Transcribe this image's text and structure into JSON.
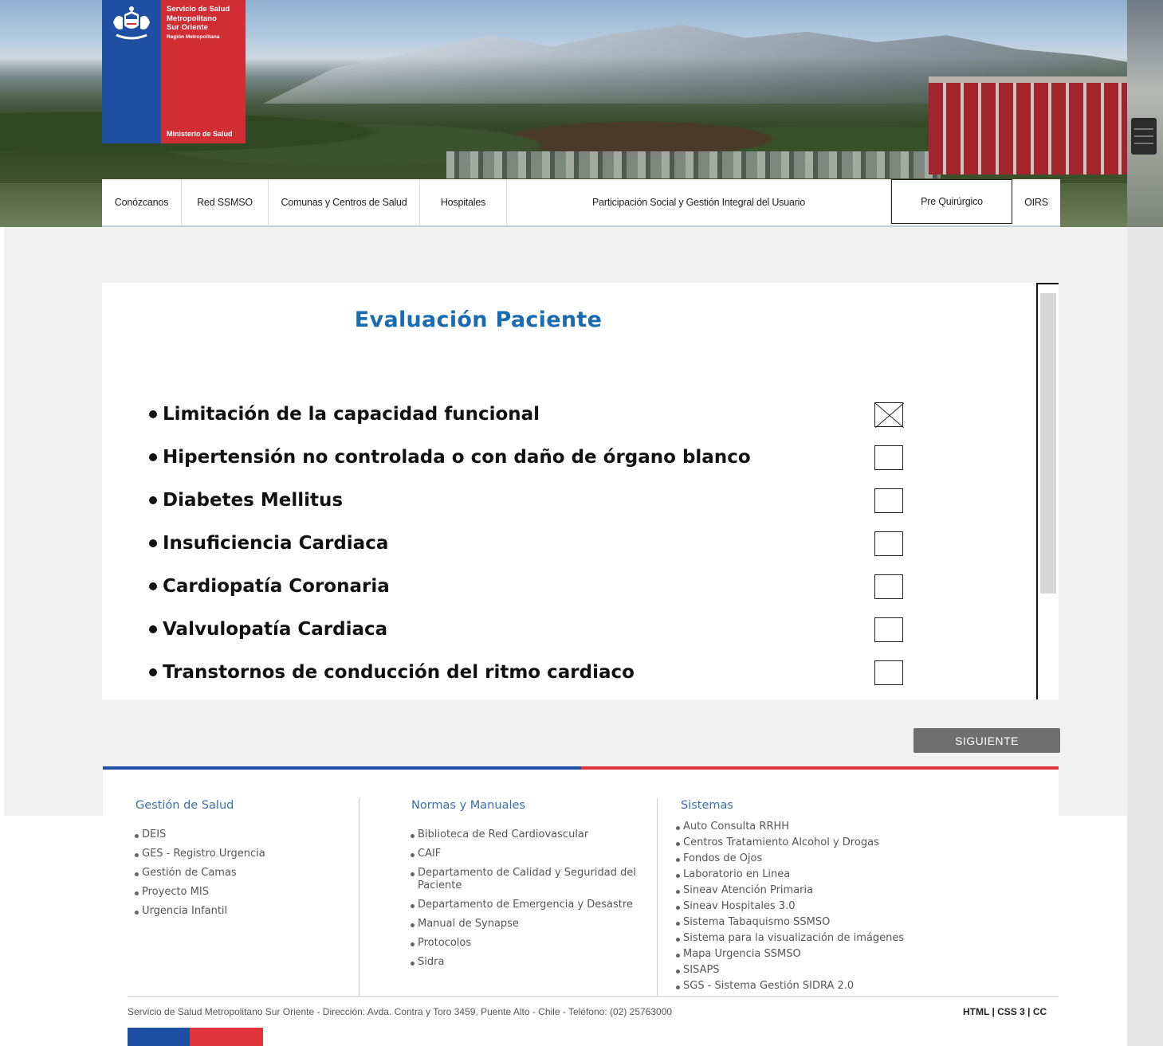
{
  "logo": {
    "line1": "Servicio de Salud",
    "line2": "Metropolitano",
    "line3": "Sur Oriente",
    "line4": "Región Metropolitana",
    "ministry": "Ministerio de Salud"
  },
  "nav": [
    {
      "label": "Conózcanos"
    },
    {
      "label": "Red SSMSO"
    },
    {
      "label": "Comunas y Centros de Salud"
    },
    {
      "label": "Hospitales"
    },
    {
      "label": "Participación Social y Gestión Integral del Usuario"
    },
    {
      "label": "Pre Quirúrgico",
      "active": true
    },
    {
      "label": "OIRS"
    }
  ],
  "form": {
    "title": "Evaluación Paciente",
    "items": [
      {
        "label": "Limitación de la capacidad funcional",
        "checked": true
      },
      {
        "label": "Hipertensión no controlada o con daño de órgano blanco",
        "checked": false
      },
      {
        "label": "Diabetes Mellitus",
        "checked": false
      },
      {
        "label": "Insuficiencia Cardiaca",
        "checked": false
      },
      {
        "label": "Cardiopatía Coronaria",
        "checked": false
      },
      {
        "label": "Valvulopatía Cardiaca",
        "checked": false
      },
      {
        "label": "Transtornos de conducción del ritmo cardiaco",
        "checked": false
      }
    ],
    "next_label": "SIGUIENTE"
  },
  "footer": {
    "col1": {
      "title": "Gestión de Salud",
      "links": [
        "DEIS",
        "GES - Registro Urgencia",
        "Gestión de Camas",
        "Proyecto MIS",
        "Urgencia Infantil"
      ]
    },
    "col2": {
      "title": "Normas y Manuales",
      "links": [
        "Biblioteca de Red Cardiovascular",
        "CAIF",
        "Departamento de Calidad y Seguridad del Paciente",
        "Departamento de Emergencia y Desastre",
        "Manual de Synapse",
        "Protocolos",
        "Sidra"
      ]
    },
    "col3": {
      "title": "Sistemas",
      "links": [
        "Auto Consulta RRHH",
        "Centros Tratamiento Alcohol y Drogas",
        "Fondos de Ojos",
        "Laboratorio en Linea",
        "Sineav Atención Primaria",
        "Sineav Hospitales 3.0",
        "Sistema Tabaquismo SSMSO",
        "Sistema para la visualización de imágenes",
        "Mapa Urgencia SSMSO",
        "SISAPS",
        "SGS - Sistema Gestión SIDRA 2.0"
      ]
    },
    "address": "Servicio de Salud Metropolitano Sur Oriente - Dirección: Avda. Contra y Toro 3459, Puente Alto - Chile - Teléfono: (02) 25763000",
    "standards": [
      "HTML",
      "CSS 3",
      "CC"
    ]
  },
  "colors": {
    "brand_blue": "#1f4fa3",
    "brand_red": "#d12d35",
    "title_blue": "#1b6bb0",
    "button_grey": "#6f6f6f"
  }
}
